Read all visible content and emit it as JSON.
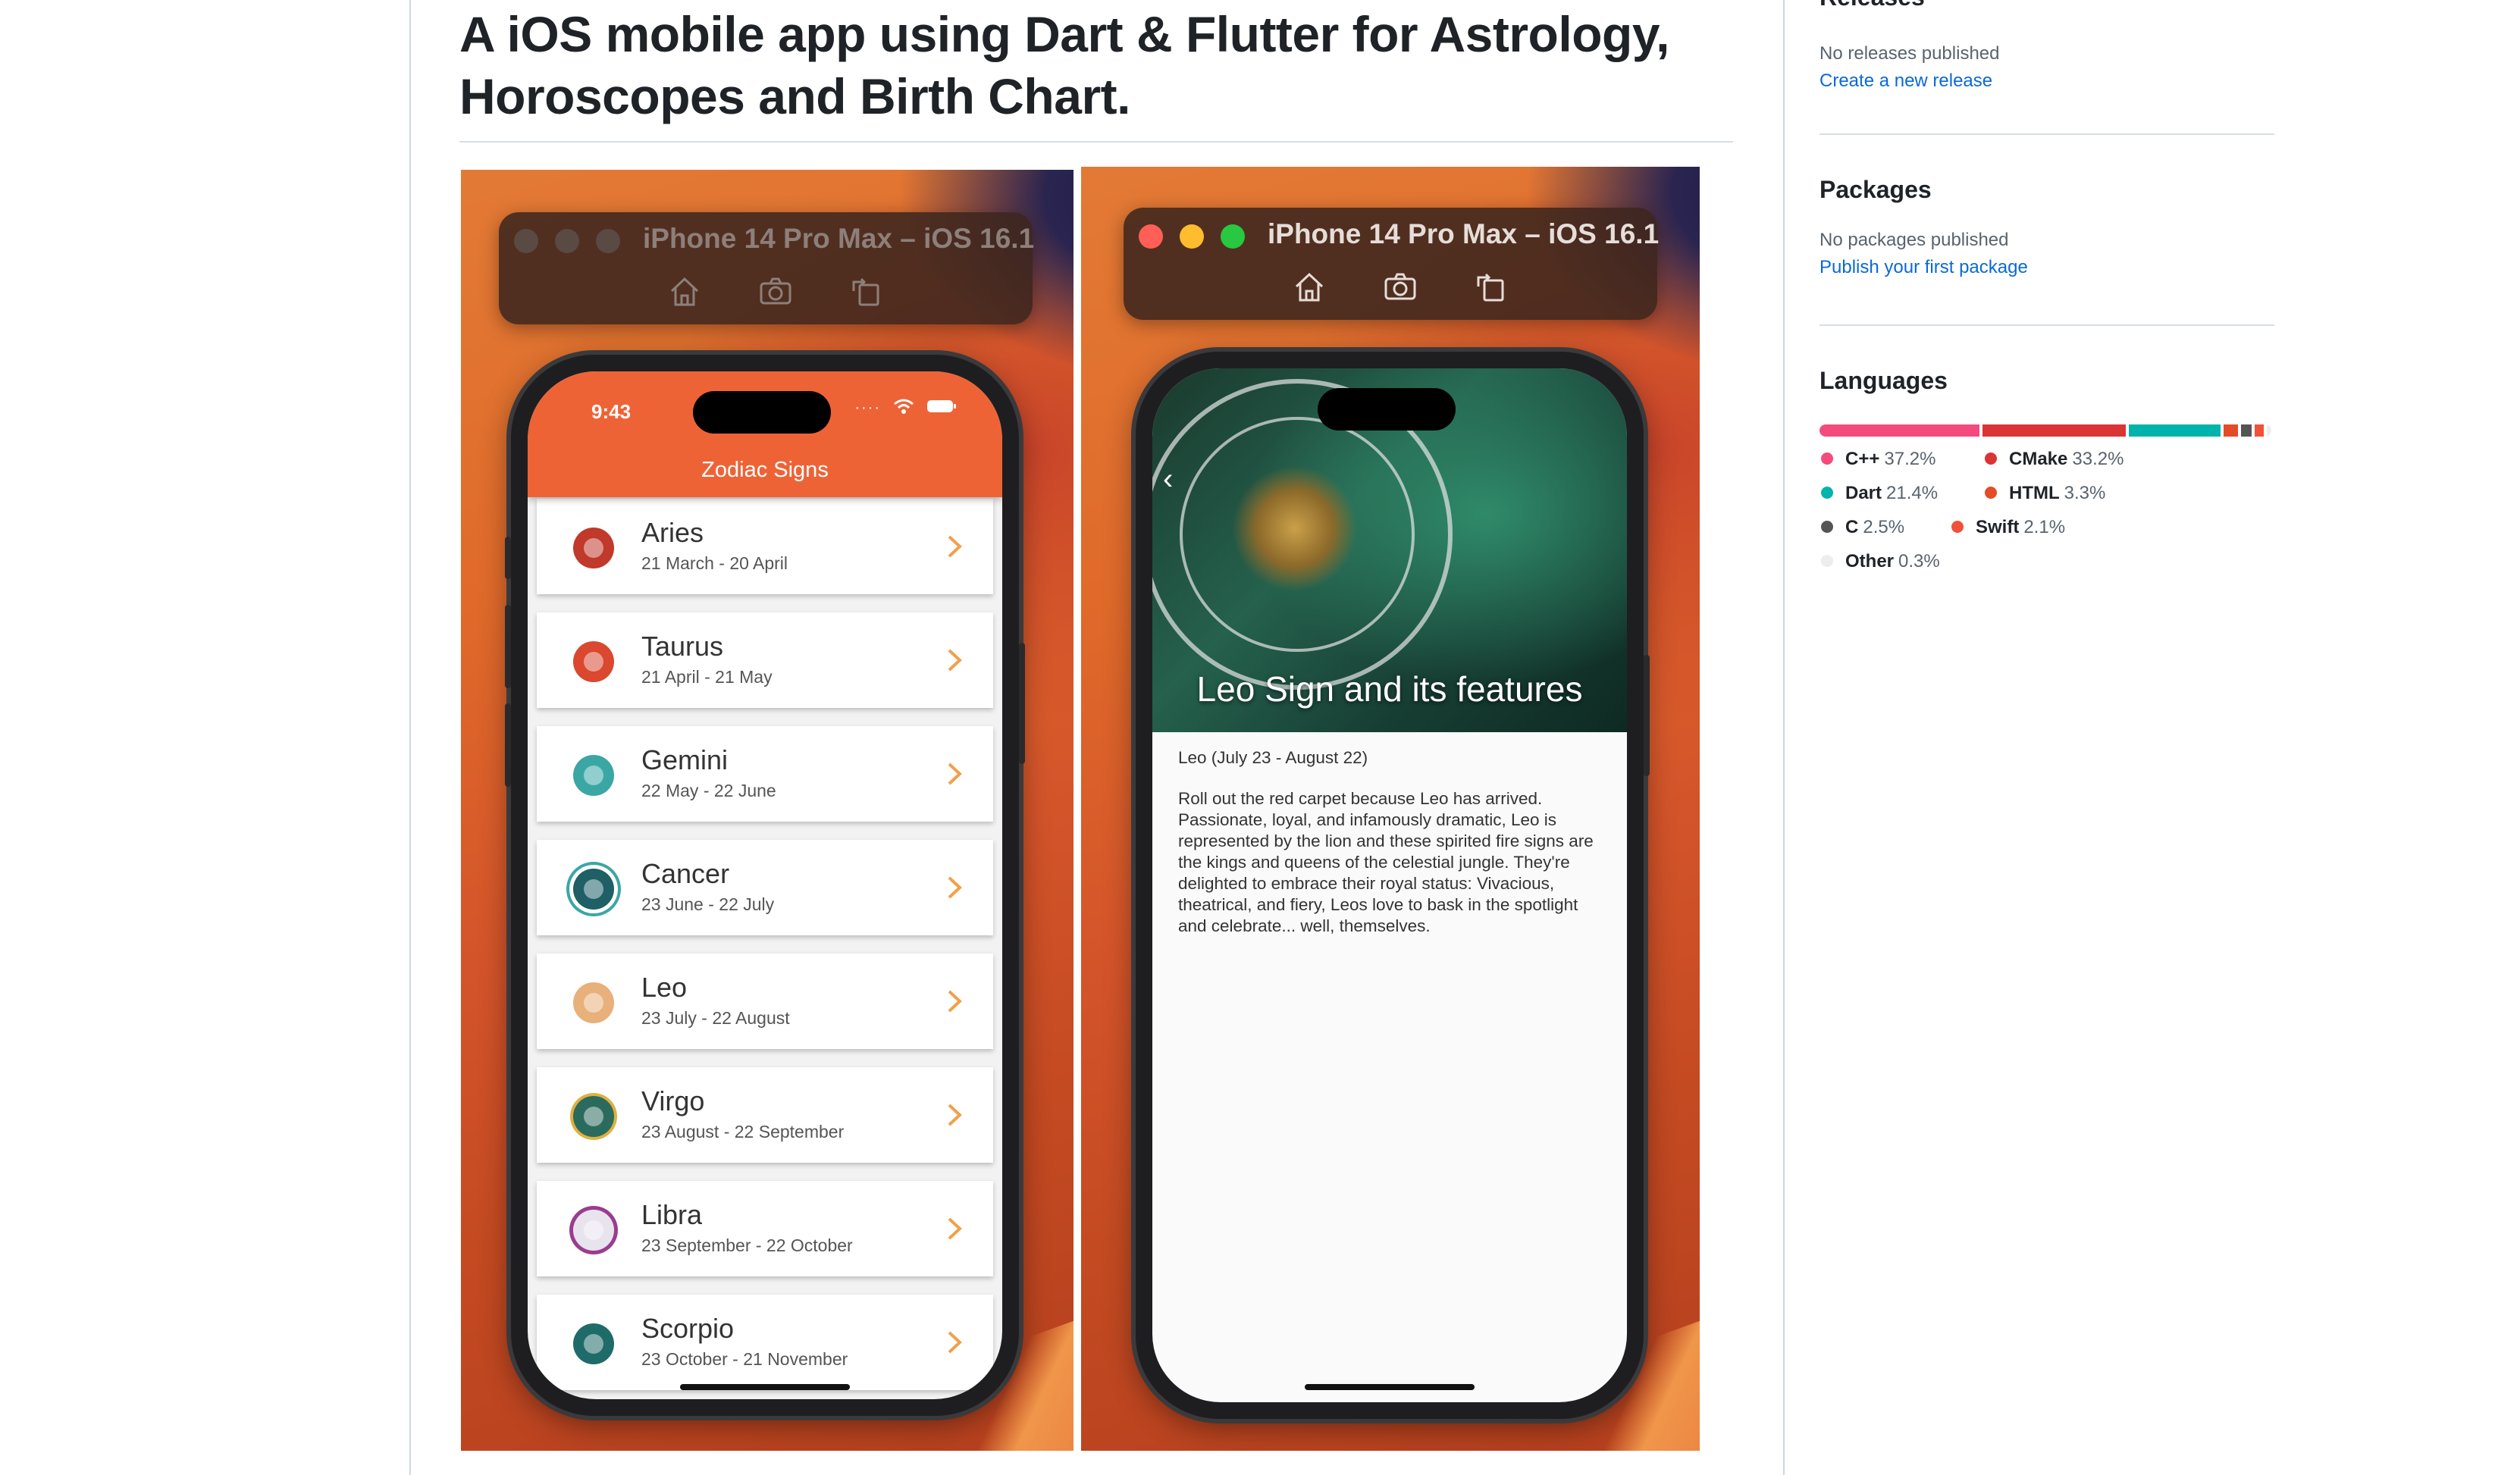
{
  "readme": {
    "title": "A iOS mobile app using Dart & Flutter for Astrology, Horoscopes and Birth Chart."
  },
  "simulator_left": {
    "title": "iPhone 14 Pro Max – iOS 16.1",
    "icons": [
      "home-icon",
      "screenshot-icon",
      "rotate-icon"
    ],
    "status_time": "9:43",
    "app_title": "Zodiac Signs",
    "signs": [
      {
        "name": "Aries",
        "dates": "21 March - 20 April",
        "color": "#c0392b"
      },
      {
        "name": "Taurus",
        "dates": "21 April - 21 May",
        "color": "#d9482f"
      },
      {
        "name": "Gemini",
        "dates": "22 May - 22 June",
        "color": "#3aa7a5"
      },
      {
        "name": "Cancer",
        "dates": "23 June - 22 July",
        "color": "#1f5f66"
      },
      {
        "name": "Leo",
        "dates": "23 July - 22 August",
        "color": "#e8b07a"
      },
      {
        "name": "Virgo",
        "dates": "23 August - 22 September",
        "color": "#2a6b5e"
      },
      {
        "name": "Libra",
        "dates": "23 September - 22 October",
        "color": "#9b3c8f"
      },
      {
        "name": "Scorpio",
        "dates": "23 October - 21 November",
        "color": "#1e6b6a"
      }
    ]
  },
  "simulator_right": {
    "title": "iPhone 14 Pro Max – iOS 16.1",
    "icons": [
      "home-icon",
      "screenshot-icon",
      "rotate-icon"
    ],
    "hero_title": "Leo Sign and its features",
    "detail_heading": "Leo (July 23 - August 22)",
    "detail_body": " Roll out the red carpet because Leo has arrived. Passionate, loyal, and infamously dramatic, Leo is represented by the lion and these spirited fire signs are the kings and queens of the celestial jungle. They're delighted to embrace their royal status: Vivacious, theatrical, and fiery, Leos love to bask in the spotlight and celebrate... well, themselves."
  },
  "sidebar": {
    "releases": {
      "heading": "Releases",
      "status": "No releases published",
      "link": "Create a new release"
    },
    "packages": {
      "heading": "Packages",
      "status": "No packages published",
      "link": "Publish your first package"
    },
    "languages": {
      "heading": "Languages",
      "items": [
        {
          "name": "C++",
          "percent": "37.2%",
          "value": 37.2,
          "color": "#f34b7d"
        },
        {
          "name": "CMake",
          "percent": "33.2%",
          "value": 33.2,
          "color": "#da3434"
        },
        {
          "name": "Dart",
          "percent": "21.4%",
          "value": 21.4,
          "color": "#00B4AB"
        },
        {
          "name": "HTML",
          "percent": "3.3%",
          "value": 3.3,
          "color": "#e34c26"
        },
        {
          "name": "C",
          "percent": "2.5%",
          "value": 2.5,
          "color": "#555555"
        },
        {
          "name": "Swift",
          "percent": "2.1%",
          "value": 2.1,
          "color": "#F05138"
        },
        {
          "name": "Other",
          "percent": "0.3%",
          "value": 0.3,
          "color": "#ededed"
        }
      ]
    }
  }
}
